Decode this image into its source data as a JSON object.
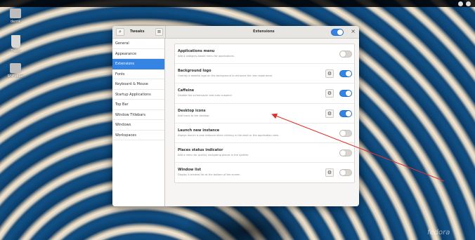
{
  "desktop": {
    "icons": [
      {
        "label": "derrik",
        "icon": "home-folder-icon"
      },
      {
        "label": "Trash",
        "icon": "trash-icon"
      },
      {
        "label": "RNFolder",
        "icon": "folder-icon"
      }
    ],
    "watermark": "fedora"
  },
  "window": {
    "app_title": "Tweaks",
    "page_title": "Extensions",
    "master_toggle_on": true,
    "search_icon": "search-icon",
    "menu_icon": "hamburger-menu-icon",
    "close_label": "×"
  },
  "sidebar": {
    "items": [
      {
        "label": "General",
        "active": false
      },
      {
        "label": "Appearance",
        "active": false
      },
      {
        "label": "Extensions",
        "active": true
      },
      {
        "label": "Fonts",
        "active": false
      },
      {
        "label": "Keyboard & Mouse",
        "active": false
      },
      {
        "label": "Startup Applications",
        "active": false
      },
      {
        "label": "Top Bar",
        "active": false
      },
      {
        "label": "Window Titlebars",
        "active": false
      },
      {
        "label": "Windows",
        "active": false
      },
      {
        "label": "Workspaces",
        "active": false
      }
    ]
  },
  "extensions": [
    {
      "name": "Applications menu",
      "desc": "Add a category-based menu for applications.",
      "enabled": false,
      "has_settings": false
    },
    {
      "name": "Background logo",
      "desc": "Overlay a tasteful logo on the background to enhance the user experience",
      "enabled": true,
      "has_settings": true
    },
    {
      "name": "Caffeine",
      "desc": "Disable the screensaver and auto suspend",
      "enabled": true,
      "has_settings": true
    },
    {
      "name": "Desktop icons",
      "desc": "Add icons to the desktop",
      "enabled": true,
      "has_settings": true
    },
    {
      "name": "Launch new instance",
      "desc": "Always launch a new instance when clicking in the dash or the application view.",
      "enabled": false,
      "has_settings": false
    },
    {
      "name": "Places status indicator",
      "desc": "Add a menu for quickly navigating places in the system.",
      "enabled": false,
      "has_settings": false
    },
    {
      "name": "Window list",
      "desc": "Display a window list at the bottom of the screen.",
      "enabled": false,
      "has_settings": true
    }
  ],
  "colors": {
    "accent": "#3584e4",
    "annotation_arrow": "#e0302a"
  }
}
